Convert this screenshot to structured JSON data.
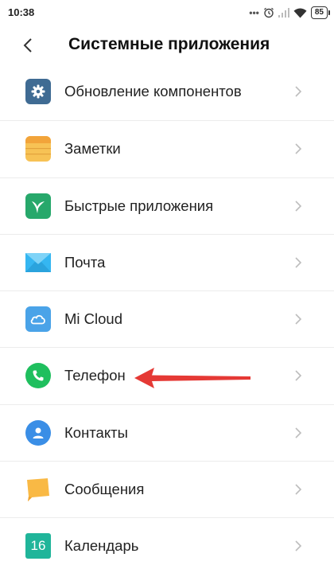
{
  "status_bar": {
    "time": "10:38",
    "dots": "•••",
    "battery": "85"
  },
  "header": {
    "title": "Системные приложения"
  },
  "items": [
    {
      "label": "Обновление компонентов",
      "icon": "gear-icon",
      "color": "#3f6b93"
    },
    {
      "label": "Заметки",
      "icon": "notes-icon",
      "color": "#f7c255"
    },
    {
      "label": "Быстрые приложения",
      "icon": "bird-icon",
      "color": "#27a86b"
    },
    {
      "label": "Почта",
      "icon": "mail-icon",
      "color": "#35b6f1"
    },
    {
      "label": "Mi Cloud",
      "icon": "cloud-icon",
      "color": "#4aa3e8"
    },
    {
      "label": "Телефон",
      "icon": "phone-icon",
      "color": "#1fbf5e"
    },
    {
      "label": "Контакты",
      "icon": "contacts-icon",
      "color": "#3a8ee6"
    },
    {
      "label": "Сообщения",
      "icon": "message-icon",
      "color": "#f9b945"
    },
    {
      "label": "Календарь",
      "icon": "calendar-icon",
      "color": "#20b59a",
      "icon_text": "16"
    }
  ],
  "annotation": {
    "arrow_color": "#e53935"
  }
}
